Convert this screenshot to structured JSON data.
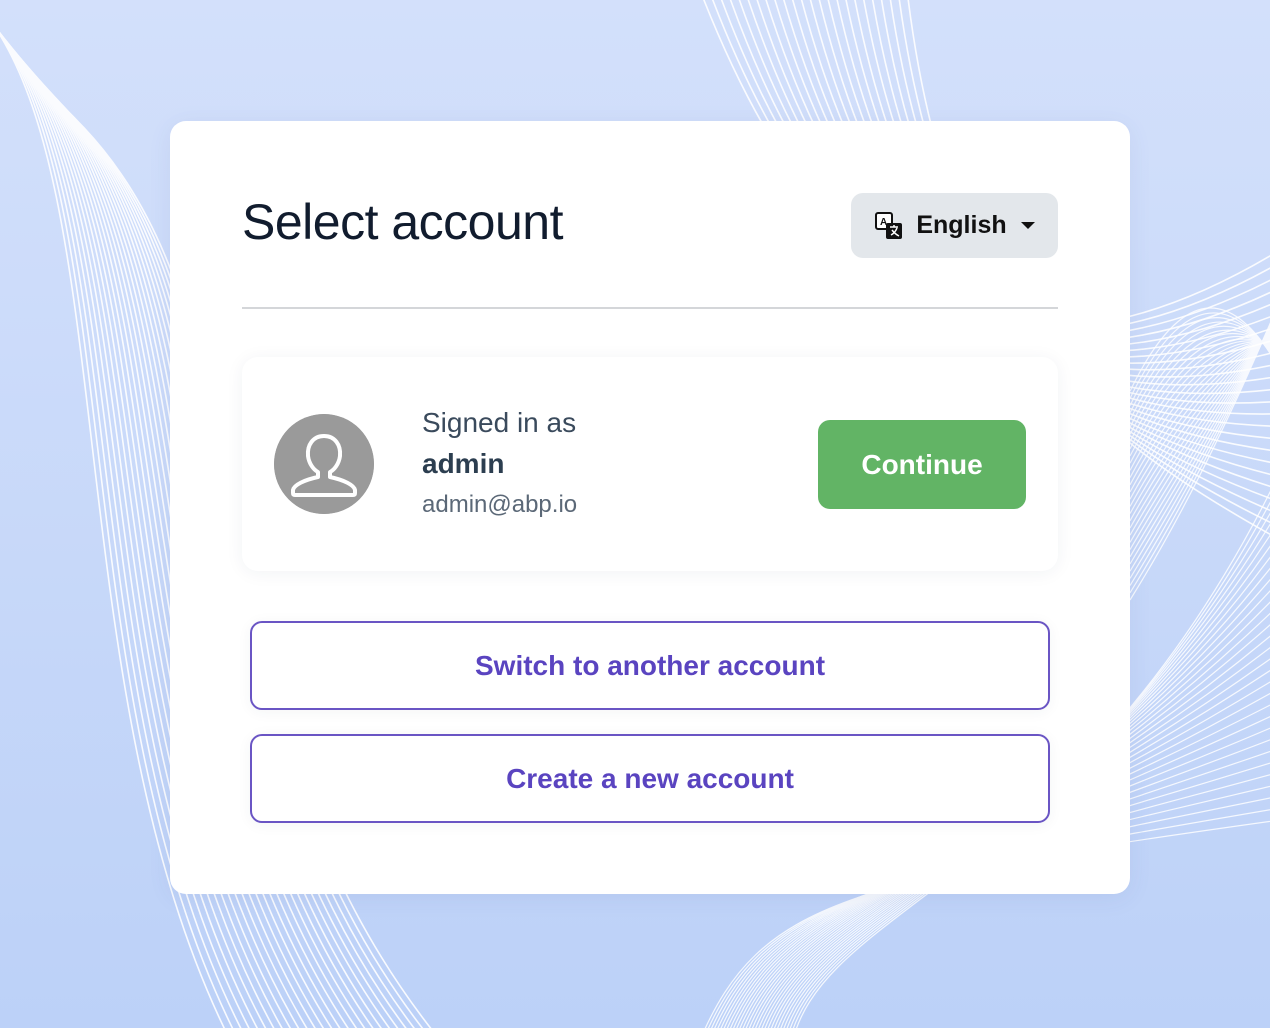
{
  "page": {
    "title": "Select account"
  },
  "language": {
    "label": "English",
    "icon": "translate-icon"
  },
  "account": {
    "signed_in_label": "Signed in as",
    "username": "admin",
    "email": "admin@abp.io",
    "avatar_icon": "user-avatar-icon",
    "continue_label": "Continue"
  },
  "actions": {
    "switch_label": "Switch to another account",
    "create_label": "Create a new account"
  },
  "colors": {
    "continue": "#62b465",
    "accent": "#5a44c0",
    "title": "#111c2e",
    "background": "#c7d8f9"
  }
}
